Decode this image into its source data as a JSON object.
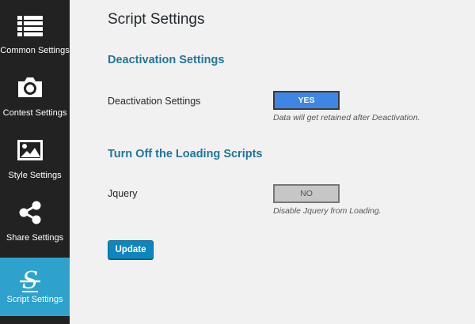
{
  "sidebar": {
    "items": [
      {
        "label": "Common Settings",
        "icon": "list-icon"
      },
      {
        "label": "Contest Settings",
        "icon": "camera-icon"
      },
      {
        "label": "Style Settings",
        "icon": "image-icon"
      },
      {
        "label": "Share Settings",
        "icon": "share-icon"
      },
      {
        "label": "Script Settings",
        "icon": "script-s-icon",
        "active": true
      }
    ],
    "active_color": "#2ea2cc"
  },
  "page": {
    "title": "Script Settings"
  },
  "sections": {
    "deactivation": {
      "title": "Deactivation Settings",
      "field_label": "Deactivation Settings",
      "toggle_value": "YES",
      "help": "Data will get retained after Deactivation."
    },
    "loading_scripts": {
      "title": "Turn Off the Loading Scripts",
      "field_label": "Jquery",
      "toggle_value": "NO",
      "help": "Disable Jquery from Loading."
    }
  },
  "actions": {
    "update_label": "Update"
  }
}
